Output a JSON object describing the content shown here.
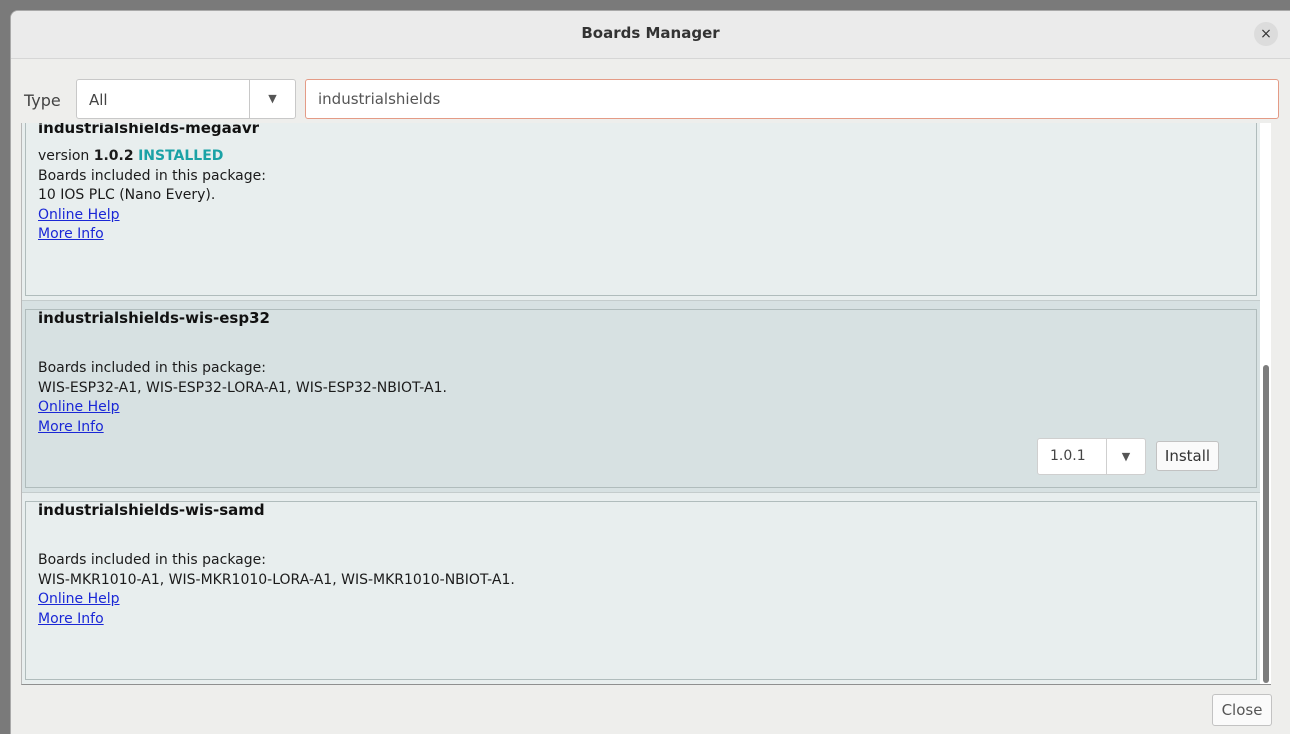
{
  "window": {
    "title": "Boards Manager",
    "close_glyph": "×"
  },
  "filter": {
    "type_label": "Type",
    "type_value": "All",
    "search_value": "industrialshields"
  },
  "entries": [
    {
      "name": "industrialshields-megaavr",
      "version_prefix": "version",
      "version": "1.0.2",
      "status": "INSTALLED",
      "boards_heading": "Boards included in this package:",
      "boards": "10 IOS PLC (Nano Every).",
      "online_help": "Online Help",
      "more_info": "More Info"
    },
    {
      "name": "industrialshields-wis-esp32",
      "boards_heading": "Boards included in this package:",
      "boards": "WIS-ESP32-A1, WIS-ESP32-LORA-A1, WIS-ESP32-NBIOT-A1.",
      "online_help": "Online Help",
      "more_info": "More Info",
      "selected_version": "1.0.1",
      "install_label": "Install"
    },
    {
      "name": "industrialshields-wis-samd",
      "boards_heading": "Boards included in this package:",
      "boards": "WIS-MKR1010-A1, WIS-MKR1010-LORA-A1, WIS-MKR1010-NBIOT-A1.",
      "online_help": "Online Help",
      "more_info": "More Info"
    }
  ],
  "footer": {
    "close_label": "Close"
  },
  "colors": {
    "installed": "#1aa2a6",
    "link": "#1a27d6",
    "entry_bg": "#e8eeee",
    "selected_entry_bg": "#d7e1e2",
    "search_border": "#e49b86"
  },
  "icons": {
    "dropdown_arrow": "chevron-down-icon",
    "window_close": "close-icon"
  }
}
